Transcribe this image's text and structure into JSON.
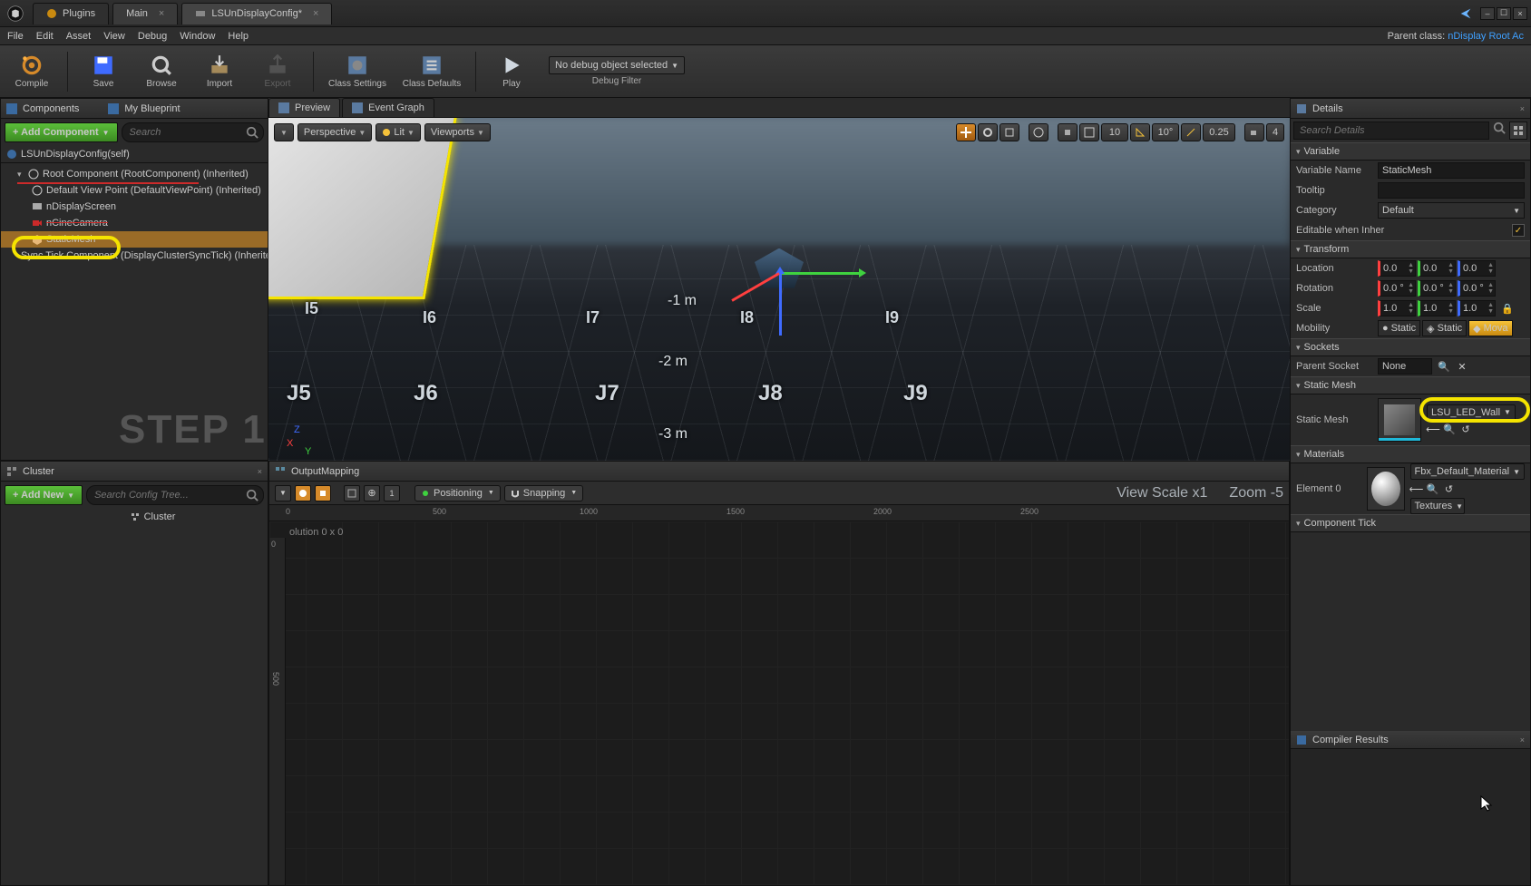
{
  "parent_class_label": "Parent class:",
  "parent_class_link": "nDisplay Root Ac",
  "doc_tabs": [
    "Plugins",
    "Main",
    "LSUnDisplayConfig*"
  ],
  "menu": [
    "File",
    "Edit",
    "Asset",
    "View",
    "Debug",
    "Window",
    "Help"
  ],
  "toolbar": {
    "compile": "Compile",
    "save": "Save",
    "browse": "Browse",
    "import": "Import",
    "export": "Export",
    "class_settings": "Class Settings",
    "class_defaults": "Class Defaults",
    "play": "Play",
    "debug_combo": "No debug object selected",
    "debug_filter": "Debug Filter"
  },
  "panels": {
    "components": "Components",
    "my_blueprint": "My Blueprint",
    "preview": "Preview",
    "event_graph": "Event Graph",
    "cluster": "Cluster",
    "output_mapping": "OutputMapping",
    "details": "Details",
    "compiler_results": "Compiler Results"
  },
  "buttons": {
    "add_component": "+ Add Component",
    "add_new": "+ Add New"
  },
  "placeholders": {
    "components_search": "Search",
    "cluster_search": "Search Config Tree...",
    "details_search": "Search Details"
  },
  "components_tree": {
    "root": "LSUnDisplayConfig(self)",
    "items": [
      "Root Component (RootComponent) (Inherited)",
      "Default View Point (DefaultViewPoint) (Inherited)",
      "nDisplayScreen",
      "nCineCamera",
      "StaticMesh",
      "Sync Tick Component (DisplayClusterSyncTick) (Inherited)"
    ]
  },
  "step_label": "STEP 1",
  "cluster_tree": {
    "root": "Cluster"
  },
  "viewport_pills": {
    "perspective": "Perspective",
    "lit": "Lit",
    "viewports": "Viewports"
  },
  "viewport_right": {
    "snap_deg": "10",
    "snap_deg2": "10°",
    "snap_scale": "0.25",
    "cam_speed": "4"
  },
  "viewport_labels": {
    "rows": [
      "I5",
      "I6",
      "I7",
      "I8",
      "I9",
      "J5",
      "J6",
      "J7",
      "J8",
      "J9"
    ],
    "meters": [
      "-1 m",
      "-2 m",
      "-3 m"
    ]
  },
  "output_mapping": {
    "positioning": "Positioning",
    "snapping": "Snapping",
    "resolution": "olution 0 x 0",
    "view_scale": "View Scale x1",
    "zoom": "Zoom -5",
    "ruler_h": [
      "0",
      "500",
      "1000",
      "1500",
      "2000",
      "2500"
    ],
    "ruler_v": [
      "0",
      "500"
    ]
  },
  "details": {
    "variable": {
      "header": "Variable",
      "name_label": "Variable Name",
      "name_value": "StaticMesh",
      "tooltip_label": "Tooltip",
      "tooltip_value": "",
      "category_label": "Category",
      "category_value": "Default",
      "editable_label": "Editable when Inher",
      "editable_value": true
    },
    "transform": {
      "header": "Transform",
      "location_label": "Location",
      "rotation_label": "Rotation",
      "scale_label": "Scale",
      "location": [
        "0.0",
        "0.0",
        "0.0"
      ],
      "rotation": [
        "0.0 °",
        "0.0 °",
        "0.0 °"
      ],
      "scale": [
        "1.0",
        "1.0",
        "1.0"
      ],
      "mobility_label": "Mobility",
      "mobility_opts": [
        "Static",
        "Static",
        "Mova"
      ]
    },
    "sockets": {
      "header": "Sockets",
      "parent_label": "Parent Socket",
      "parent_value": ""
    },
    "static_mesh": {
      "header": "Static Mesh",
      "label": "Static Mesh",
      "asset": "LSU_LED_Wall",
      "none": "None"
    },
    "materials": {
      "header": "Materials",
      "element0_label": "Element 0",
      "material_name": "Fbx_Default_Material",
      "textures": "Textures"
    },
    "component_tick": {
      "header": "Component Tick"
    }
  }
}
